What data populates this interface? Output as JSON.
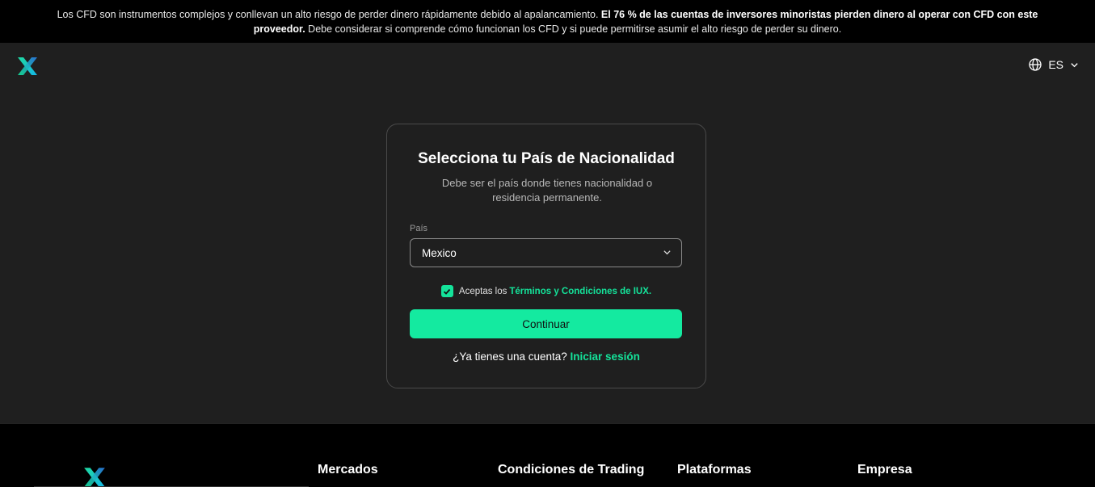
{
  "banner": {
    "text_part1": "Los CFD son instrumentos complejos y conllevan un alto riesgo de perder dinero rápidamente debido al apalancamiento.",
    "text_bold": "El 76 % de las cuentas de inversores minoristas pierden dinero al operar con CFD con este proveedor.",
    "text_part2": "Debe considerar si comprende cómo funcionan los CFD y si puede permitirse asumir el alto riesgo de perder su dinero."
  },
  "header": {
    "logo_icon": "iux-x-logo",
    "language_icon": "globe-icon",
    "language": "ES",
    "language_chevron": "chevron-down-icon"
  },
  "card": {
    "title": "Selecciona tu País de Nacionalidad",
    "subtitle": "Debe ser el país donde tienes nacionalidad o residencia permanente.",
    "country_label": "País",
    "country_value": "Mexico",
    "terms_checked": true,
    "terms_prefix": "Aceptas los",
    "terms_link": "Términos y Condiciones de IUX.",
    "continue_label": "Continuar",
    "login_prompt": "¿Ya tienes una cuenta?",
    "login_link": "Iniciar sesión"
  },
  "footer": {
    "columns": [
      "Mercados",
      "Condiciones de Trading",
      "Plataformas",
      "Empresa"
    ]
  },
  "colors": {
    "accent": "#14e39a",
    "background": "#1f1f1f",
    "banner_bg": "#000000"
  }
}
